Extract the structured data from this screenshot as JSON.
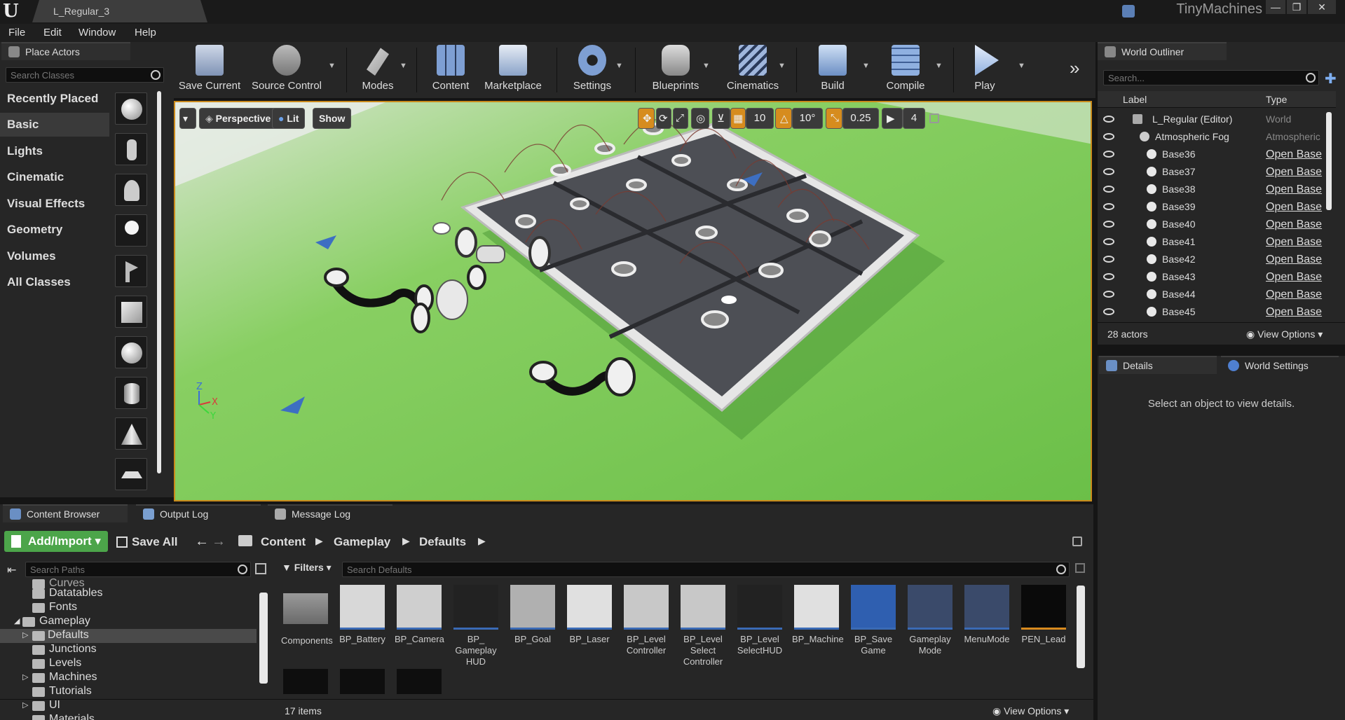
{
  "titlebar": {
    "tab_title": "L_Regular_3",
    "project_name": "TinyMachines",
    "controls": [
      "—",
      "❐",
      "✕"
    ]
  },
  "menu": [
    "File",
    "Edit",
    "Window",
    "Help"
  ],
  "place_actors": {
    "title": "Place Actors",
    "search_placeholder": "Search Classes",
    "categories": [
      "Recently Placed",
      "Basic",
      "Lights",
      "Cinematic",
      "Visual Effects",
      "Geometry",
      "Volumes",
      "All Classes"
    ],
    "selected": "Basic"
  },
  "toolbar": {
    "buttons": [
      "Save Current",
      "Source Control",
      "Modes",
      "Content",
      "Marketplace",
      "Settings",
      "Blueprints",
      "Cinematics",
      "Build",
      "Compile",
      "Play"
    ]
  },
  "viewport": {
    "view_mode": "Perspective",
    "lighting": "Lit",
    "show": "Show",
    "grid_snap": "10",
    "rotation_snap": "10°",
    "scale_snap": "0.25",
    "camera_speed": "4",
    "axes": [
      "Z",
      "X",
      "Y"
    ]
  },
  "outliner": {
    "title": "World Outliner",
    "search_placeholder": "Search...",
    "col_label": "Label",
    "col_type": "Type",
    "rows": [
      {
        "label": "L_Regular (Editor)",
        "type": "World"
      },
      {
        "label": "Atmospheric Fog",
        "type": "Atmospheric"
      },
      {
        "label": "Base36",
        "type": "Open Base"
      },
      {
        "label": "Base37",
        "type": "Open Base"
      },
      {
        "label": "Base38",
        "type": "Open Base"
      },
      {
        "label": "Base39",
        "type": "Open Base"
      },
      {
        "label": "Base40",
        "type": "Open Base"
      },
      {
        "label": "Base41",
        "type": "Open Base"
      },
      {
        "label": "Base42",
        "type": "Open Base"
      },
      {
        "label": "Base43",
        "type": "Open Base"
      },
      {
        "label": "Base44",
        "type": "Open Base"
      },
      {
        "label": "Base45",
        "type": "Open Base"
      }
    ],
    "actor_count": "28 actors",
    "view_options": "View Options"
  },
  "details": {
    "tab_details": "Details",
    "tab_world": "World Settings",
    "empty_message": "Select an object to view details."
  },
  "content_browser": {
    "tabs": [
      "Content Browser",
      "Output Log",
      "Message Log"
    ],
    "add_import": "Add/Import",
    "save_all": "Save All",
    "breadcrumb": [
      "Content",
      "Gameplay",
      "Defaults"
    ],
    "search_paths_placeholder": "Search Paths",
    "filters": "Filters",
    "search_defaults_placeholder": "Search Defaults",
    "folders": [
      "Curves",
      "Datatables",
      "Fonts",
      "Gameplay",
      "Defaults",
      "Junctions",
      "Levels",
      "Machines",
      "Tutorials",
      "UI",
      "Materials"
    ],
    "assets": [
      "Components",
      "BP_Battery",
      "BP_Camera",
      "BP_\nGameplay\nHUD",
      "BP_Goal",
      "BP_Laser",
      "BP_Level\nController",
      "BP_Level\nSelect\nController",
      "BP_Level\nSelectHUD",
      "BP_Machine",
      "BP_Save\nGame",
      "Gameplay\nMode",
      "MenuMode",
      "PEN_Lead"
    ],
    "item_count": "17 items",
    "view_options": "View Options"
  }
}
